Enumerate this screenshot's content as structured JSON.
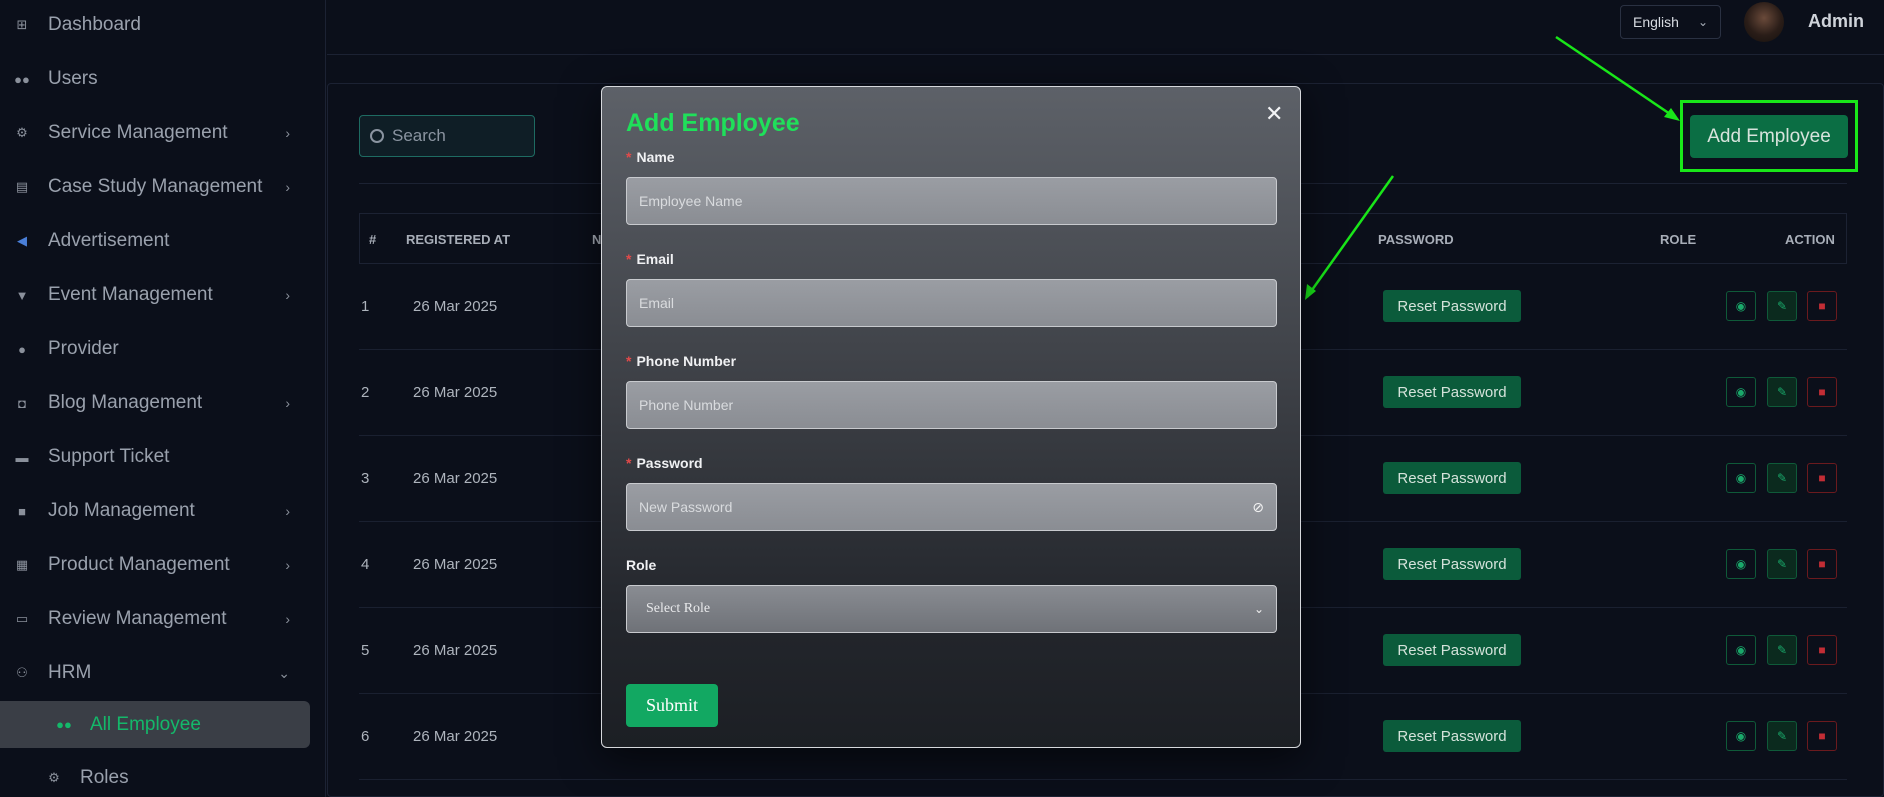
{
  "sidebar": {
    "items": [
      {
        "label": "Dashboard",
        "icon": "grid-icon"
      },
      {
        "label": "Users",
        "icon": "users-icon"
      },
      {
        "label": "Service Management",
        "icon": "service-icon",
        "expandable": true
      },
      {
        "label": "Case Study Management",
        "icon": "document-icon",
        "expandable": true
      },
      {
        "label": "Advertisement",
        "icon": "megaphone-icon"
      },
      {
        "label": "Event Management",
        "icon": "trophy-icon",
        "expandable": true
      },
      {
        "label": "Provider",
        "icon": "person-icon"
      },
      {
        "label": "Blog Management",
        "icon": "blog-icon",
        "expandable": true
      },
      {
        "label": "Support Ticket",
        "icon": "ticket-icon"
      },
      {
        "label": "Job Management",
        "icon": "briefcase-icon",
        "expandable": true
      },
      {
        "label": "Product Management",
        "icon": "product-icon",
        "expandable": true
      },
      {
        "label": "Review Management",
        "icon": "review-icon",
        "expandable": true
      },
      {
        "label": "HRM",
        "icon": "hrm-icon",
        "expanded": true
      }
    ],
    "sub_items": [
      {
        "label": "All Employee",
        "icon": "users-icon",
        "active": true
      },
      {
        "label": "Roles",
        "icon": "roles-icon"
      }
    ]
  },
  "header": {
    "language": "English",
    "user": "Admin"
  },
  "toolbar": {
    "search_placeholder": "Search",
    "add_button": "Add Employee"
  },
  "table": {
    "columns": [
      "#",
      "REGISTERED AT",
      "N",
      "PASSWORD",
      "ROLE",
      "ACTION"
    ],
    "rows": [
      {
        "idx": "1",
        "date": "26 Mar 2025",
        "reset": "Reset Password"
      },
      {
        "idx": "2",
        "date": "26 Mar 2025",
        "reset": "Reset Password"
      },
      {
        "idx": "3",
        "date": "26 Mar 2025",
        "reset": "Reset Password"
      },
      {
        "idx": "4",
        "date": "26 Mar 2025",
        "reset": "Reset Password"
      },
      {
        "idx": "5",
        "date": "26 Mar 2025",
        "reset": "Reset Password"
      },
      {
        "idx": "6",
        "date": "26 Mar 2025",
        "reset": "Reset Password"
      }
    ]
  },
  "modal": {
    "title": "Add Employee",
    "fields": {
      "name": {
        "label": "Name",
        "placeholder": "Employee Name",
        "required": true
      },
      "email": {
        "label": "Email",
        "placeholder": "Email",
        "required": true
      },
      "phone": {
        "label": "Phone Number",
        "placeholder": "Phone Number",
        "required": true
      },
      "password": {
        "label": "Password",
        "placeholder": "New Password",
        "required": true
      },
      "role": {
        "label": "Role",
        "placeholder": "Select Role"
      }
    },
    "submit_label": "Submit"
  },
  "colors": {
    "accent": "#12a862",
    "title_green": "#1fe05a",
    "highlight": "#19e619",
    "danger": "#c22d35"
  }
}
